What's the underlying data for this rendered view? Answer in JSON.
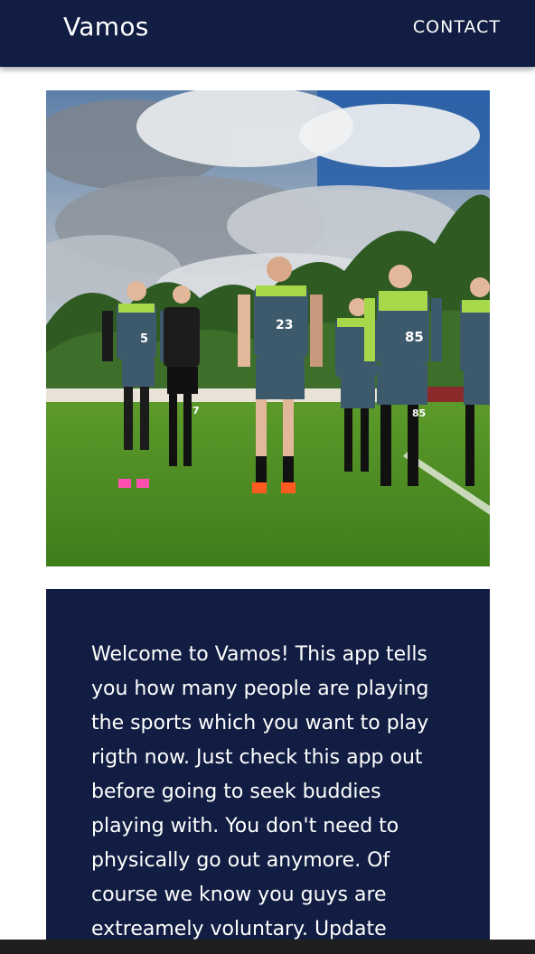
{
  "app_bar": {
    "title": "Vamos",
    "contact_label": "CONTACT",
    "background": "#111d42"
  },
  "hero": {
    "description": "photo-soccer-team-walking-on-pitch",
    "jersey_numbers": [
      "5",
      "7",
      "23",
      "85",
      "85"
    ]
  },
  "card": {
    "background": "#111d42",
    "text": "Welcome to Vamos! This app tells you how many people are playing the sports which you want to play rigth now. Just check this app out before going to seek buddies playing with. You don't need to physically go out anymore. Of course we know you guys are extreamely voluntary. Update"
  }
}
